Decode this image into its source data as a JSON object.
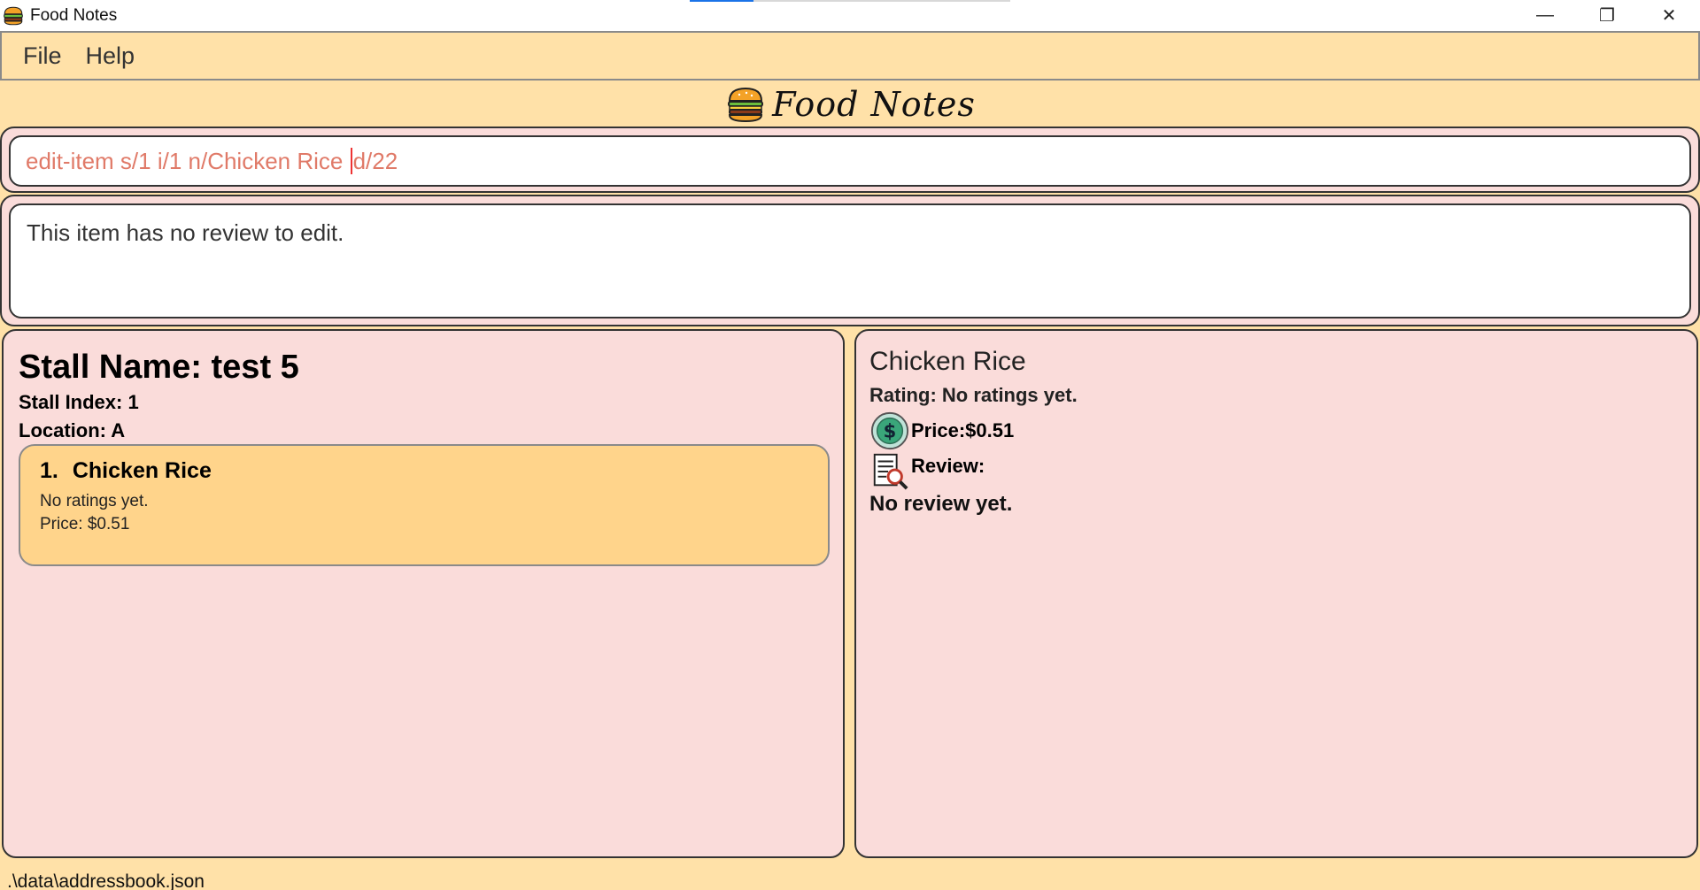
{
  "window": {
    "title": "Food Notes",
    "minimize_glyph": "—",
    "restore_glyph": "❐",
    "close_glyph": "✕"
  },
  "menu": {
    "items": [
      {
        "label": "File"
      },
      {
        "label": "Help"
      }
    ]
  },
  "header": {
    "logo_icon": "burger-icon",
    "logo_text": "Food Notes"
  },
  "command": {
    "text_before_caret": "edit-item s/1 i/1 n/Chicken Rice ",
    "text_after_caret": "d/22"
  },
  "result": {
    "message": "This item has no review to edit."
  },
  "stall": {
    "name_line": "Stall Name: test 5",
    "index_line": "Stall Index: 1",
    "location_line": "Location: A",
    "items": [
      {
        "number": "1.",
        "name": "Chicken Rice",
        "rating": "No ratings yet.",
        "price": "Price: $0.51"
      }
    ]
  },
  "detail": {
    "name": "Chicken Rice",
    "rating_line": "Rating: No ratings yet.",
    "price_icon": "dollar-icon",
    "price_line": "Price:$0.51",
    "review_icon": "review-search-icon",
    "review_label": "Review:",
    "review_text": "No review yet."
  },
  "status": {
    "path": ".\\data\\addressbook.json"
  },
  "colors": {
    "background": "#ffe1a8",
    "panel": "#fadcda",
    "item_card": "#ffd48b",
    "command_text": "#e07a68"
  }
}
